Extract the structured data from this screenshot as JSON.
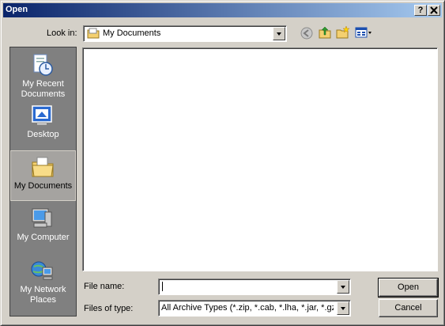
{
  "window": {
    "title": "Open",
    "help_button": "?",
    "close_button": "X"
  },
  "lookin": {
    "label": "Look in:",
    "value": "My Documents"
  },
  "toolbar": {
    "icons": [
      "back-icon",
      "up-folder-icon",
      "new-folder-icon",
      "view-menu-icon"
    ]
  },
  "places": {
    "items": [
      {
        "label": "My Recent Documents",
        "icon": "recent-documents-icon"
      },
      {
        "label": "Desktop",
        "icon": "desktop-icon"
      },
      {
        "label": "My Documents",
        "icon": "my-documents-icon"
      },
      {
        "label": "My Computer",
        "icon": "my-computer-icon"
      },
      {
        "label": "My Network Places",
        "icon": "network-places-icon"
      }
    ],
    "selected_index": 2
  },
  "filename": {
    "label": "File name:",
    "value": ""
  },
  "filetype": {
    "label": "Files of type:",
    "value": "All Archive Types (*.zip, *.cab, *.lha, *.jar, *.gz, *"
  },
  "buttons": {
    "open": "Open",
    "cancel": "Cancel"
  },
  "colors": {
    "title_gradient_start": "#0a246a",
    "title_gradient_end": "#a6caf0",
    "face": "#d4d0c8",
    "places_bg": "#808080"
  }
}
